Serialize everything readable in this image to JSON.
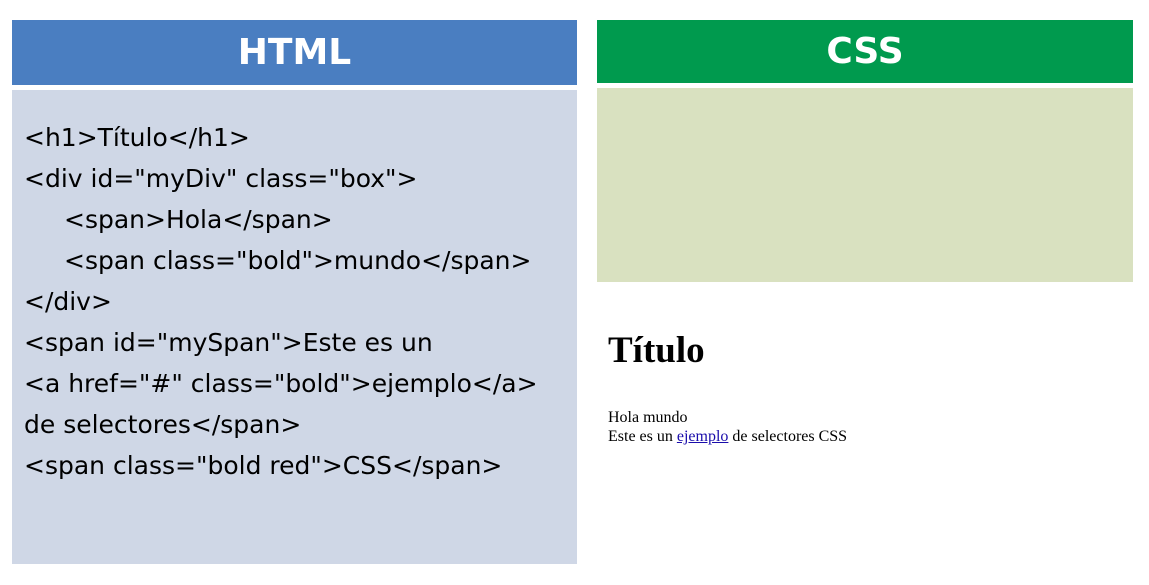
{
  "html_panel": {
    "title": "HTML",
    "lines": [
      "<h1>Título</h1>",
      "<div id=\"myDiv\" class=\"box\">",
      "<span>Hola</span>",
      "<span class=\"bold\">mundo</span>",
      "</div>",
      "<span id=\"mySpan\">Este es un",
      "<a href=\"#\" class=\"bold\">ejemplo</a>",
      "de selectores</span>",
      "<span class=\"bold red\">CSS</span>"
    ]
  },
  "css_panel": {
    "title": "CSS"
  },
  "preview": {
    "title": "Título",
    "line1": "Hola mundo",
    "line2_before": "Este es un",
    "link": "ejemplo",
    "line2_after": "de selectores CSS"
  },
  "colors": {
    "html_header": "#4a7ec1",
    "html_body": "#cfd7e6",
    "css_header": "#009a4e",
    "css_body": "#d9e1c0",
    "link": "#1a0dab"
  }
}
